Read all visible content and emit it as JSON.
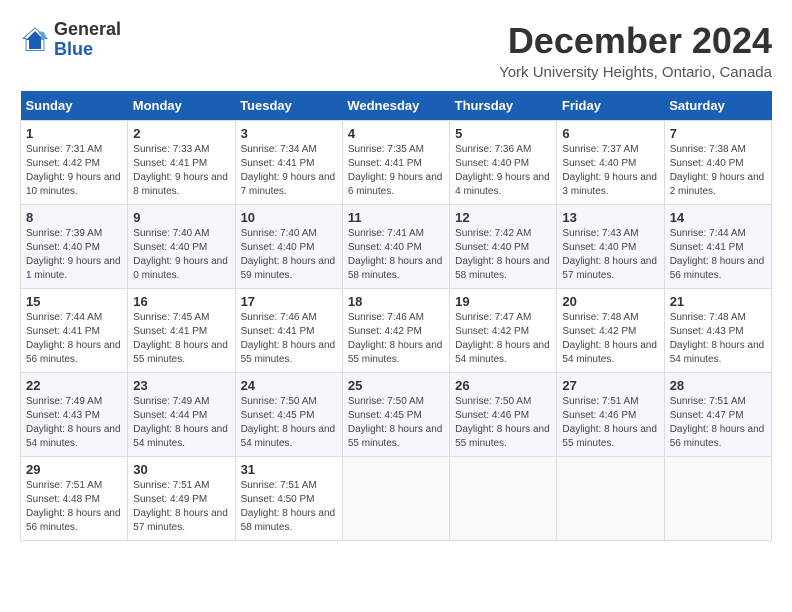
{
  "header": {
    "logo_general": "General",
    "logo_blue": "Blue",
    "title": "December 2024",
    "subtitle": "York University Heights, Ontario, Canada"
  },
  "calendar": {
    "days_of_week": [
      "Sunday",
      "Monday",
      "Tuesday",
      "Wednesday",
      "Thursday",
      "Friday",
      "Saturday"
    ],
    "weeks": [
      [
        {
          "day": "1",
          "info": "Sunrise: 7:31 AM\nSunset: 4:42 PM\nDaylight: 9 hours and 10 minutes."
        },
        {
          "day": "2",
          "info": "Sunrise: 7:33 AM\nSunset: 4:41 PM\nDaylight: 9 hours and 8 minutes."
        },
        {
          "day": "3",
          "info": "Sunrise: 7:34 AM\nSunset: 4:41 PM\nDaylight: 9 hours and 7 minutes."
        },
        {
          "day": "4",
          "info": "Sunrise: 7:35 AM\nSunset: 4:41 PM\nDaylight: 9 hours and 6 minutes."
        },
        {
          "day": "5",
          "info": "Sunrise: 7:36 AM\nSunset: 4:40 PM\nDaylight: 9 hours and 4 minutes."
        },
        {
          "day": "6",
          "info": "Sunrise: 7:37 AM\nSunset: 4:40 PM\nDaylight: 9 hours and 3 minutes."
        },
        {
          "day": "7",
          "info": "Sunrise: 7:38 AM\nSunset: 4:40 PM\nDaylight: 9 hours and 2 minutes."
        }
      ],
      [
        {
          "day": "8",
          "info": "Sunrise: 7:39 AM\nSunset: 4:40 PM\nDaylight: 9 hours and 1 minute."
        },
        {
          "day": "9",
          "info": "Sunrise: 7:40 AM\nSunset: 4:40 PM\nDaylight: 9 hours and 0 minutes."
        },
        {
          "day": "10",
          "info": "Sunrise: 7:40 AM\nSunset: 4:40 PM\nDaylight: 8 hours and 59 minutes."
        },
        {
          "day": "11",
          "info": "Sunrise: 7:41 AM\nSunset: 4:40 PM\nDaylight: 8 hours and 58 minutes."
        },
        {
          "day": "12",
          "info": "Sunrise: 7:42 AM\nSunset: 4:40 PM\nDaylight: 8 hours and 58 minutes."
        },
        {
          "day": "13",
          "info": "Sunrise: 7:43 AM\nSunset: 4:40 PM\nDaylight: 8 hours and 57 minutes."
        },
        {
          "day": "14",
          "info": "Sunrise: 7:44 AM\nSunset: 4:41 PM\nDaylight: 8 hours and 56 minutes."
        }
      ],
      [
        {
          "day": "15",
          "info": "Sunrise: 7:44 AM\nSunset: 4:41 PM\nDaylight: 8 hours and 56 minutes."
        },
        {
          "day": "16",
          "info": "Sunrise: 7:45 AM\nSunset: 4:41 PM\nDaylight: 8 hours and 55 minutes."
        },
        {
          "day": "17",
          "info": "Sunrise: 7:46 AM\nSunset: 4:41 PM\nDaylight: 8 hours and 55 minutes."
        },
        {
          "day": "18",
          "info": "Sunrise: 7:46 AM\nSunset: 4:42 PM\nDaylight: 8 hours and 55 minutes."
        },
        {
          "day": "19",
          "info": "Sunrise: 7:47 AM\nSunset: 4:42 PM\nDaylight: 8 hours and 54 minutes."
        },
        {
          "day": "20",
          "info": "Sunrise: 7:48 AM\nSunset: 4:42 PM\nDaylight: 8 hours and 54 minutes."
        },
        {
          "day": "21",
          "info": "Sunrise: 7:48 AM\nSunset: 4:43 PM\nDaylight: 8 hours and 54 minutes."
        }
      ],
      [
        {
          "day": "22",
          "info": "Sunrise: 7:49 AM\nSunset: 4:43 PM\nDaylight: 8 hours and 54 minutes."
        },
        {
          "day": "23",
          "info": "Sunrise: 7:49 AM\nSunset: 4:44 PM\nDaylight: 8 hours and 54 minutes."
        },
        {
          "day": "24",
          "info": "Sunrise: 7:50 AM\nSunset: 4:45 PM\nDaylight: 8 hours and 54 minutes."
        },
        {
          "day": "25",
          "info": "Sunrise: 7:50 AM\nSunset: 4:45 PM\nDaylight: 8 hours and 55 minutes."
        },
        {
          "day": "26",
          "info": "Sunrise: 7:50 AM\nSunset: 4:46 PM\nDaylight: 8 hours and 55 minutes."
        },
        {
          "day": "27",
          "info": "Sunrise: 7:51 AM\nSunset: 4:46 PM\nDaylight: 8 hours and 55 minutes."
        },
        {
          "day": "28",
          "info": "Sunrise: 7:51 AM\nSunset: 4:47 PM\nDaylight: 8 hours and 56 minutes."
        }
      ],
      [
        {
          "day": "29",
          "info": "Sunrise: 7:51 AM\nSunset: 4:48 PM\nDaylight: 8 hours and 56 minutes."
        },
        {
          "day": "30",
          "info": "Sunrise: 7:51 AM\nSunset: 4:49 PM\nDaylight: 8 hours and 57 minutes."
        },
        {
          "day": "31",
          "info": "Sunrise: 7:51 AM\nSunset: 4:50 PM\nDaylight: 8 hours and 58 minutes."
        },
        {
          "day": "",
          "info": ""
        },
        {
          "day": "",
          "info": ""
        },
        {
          "day": "",
          "info": ""
        },
        {
          "day": "",
          "info": ""
        }
      ]
    ]
  }
}
